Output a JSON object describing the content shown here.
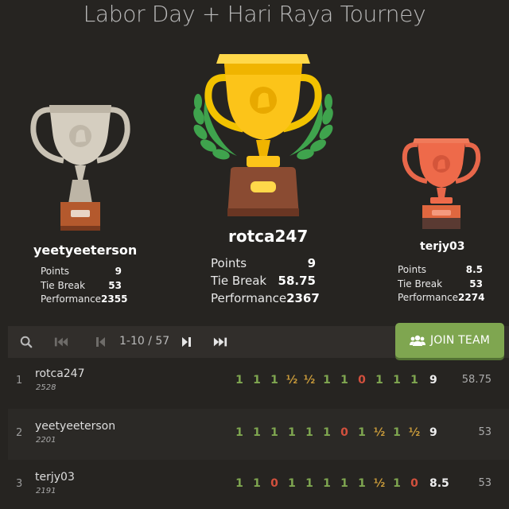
{
  "title": "Labor Day + Hari Raya Tourney",
  "podium": {
    "second": {
      "name": "yeetyeeterson",
      "points_label": "Points",
      "points": "9",
      "tiebreak_label": "Tie Break",
      "tiebreak": "53",
      "performance_label": "Performance",
      "performance": "2355"
    },
    "first": {
      "name": "rotca247",
      "points_label": "Points",
      "points": "9",
      "tiebreak_label": "Tie Break",
      "tiebreak": "58.75",
      "performance_label": "Performance",
      "performance": "2367"
    },
    "third": {
      "name": "terjy03",
      "points_label": "Points",
      "points": "8.5",
      "tiebreak_label": "Tie Break",
      "tiebreak": "53",
      "performance_label": "Performance",
      "performance": "2274"
    }
  },
  "toolbar": {
    "pager_text": "1-10 / 57",
    "join_label": "JOIN TEAM",
    "icons": [
      "search-icon",
      "first-page-icon",
      "prev-page-icon",
      "next-page-icon",
      "last-page-icon"
    ]
  },
  "colors": {
    "win": "#7fa650",
    "draw": "#c89a3a",
    "loss": "#d2503d",
    "button": "#7fa650"
  },
  "standings": [
    {
      "rank": "1",
      "name": "rotca247",
      "rating": "2528",
      "results": [
        "1",
        "1",
        "1",
        "½",
        "½",
        "1",
        "1",
        "0",
        "1",
        "1",
        "1"
      ],
      "score": "9",
      "tiebreak": "58.75"
    },
    {
      "rank": "2",
      "name": "yeetyeeterson",
      "rating": "2201",
      "results": [
        "1",
        "1",
        "1",
        "1",
        "1",
        "1",
        "0",
        "1",
        "½",
        "1",
        "½"
      ],
      "score": "9",
      "tiebreak": "53"
    },
    {
      "rank": "3",
      "name": "terjy03",
      "rating": "2191",
      "results": [
        "1",
        "1",
        "0",
        "1",
        "1",
        "1",
        "1",
        "1",
        "½",
        "1",
        "0"
      ],
      "score": "8.5",
      "tiebreak": "53"
    }
  ]
}
